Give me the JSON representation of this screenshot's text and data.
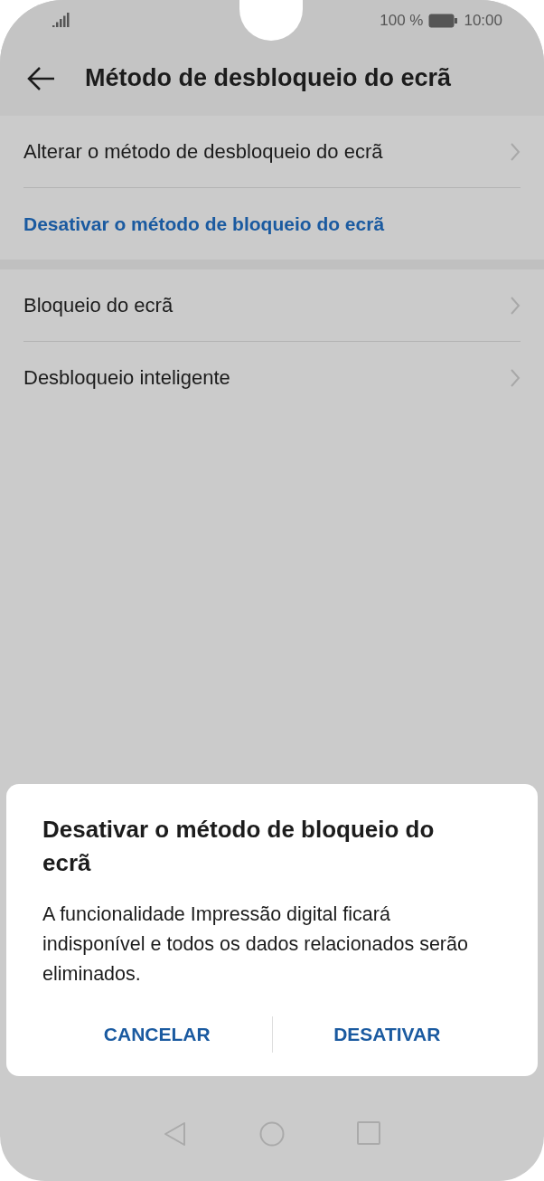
{
  "status_bar": {
    "battery": "100 %",
    "time": "10:00"
  },
  "header": {
    "title": "Método de desbloqueio do ecrã"
  },
  "sections": [
    {
      "items": [
        {
          "label": "Alterar o método de desbloqueio do ecrã",
          "kind": "nav"
        },
        {
          "label": "Desativar o método de bloqueio do ecrã",
          "kind": "action"
        }
      ]
    },
    {
      "items": [
        {
          "label": "Bloqueio do ecrã",
          "kind": "nav"
        },
        {
          "label": "Desbloqueio inteligente",
          "kind": "nav"
        }
      ]
    }
  ],
  "dialog": {
    "title": "Desativar o método de bloqueio do ecrã",
    "message": "A funcionalidade Impressão digital ficará indisponível e todos os dados relacionados serão eliminados.",
    "buttons": [
      "CANCELAR",
      "DESATIVAR"
    ]
  }
}
